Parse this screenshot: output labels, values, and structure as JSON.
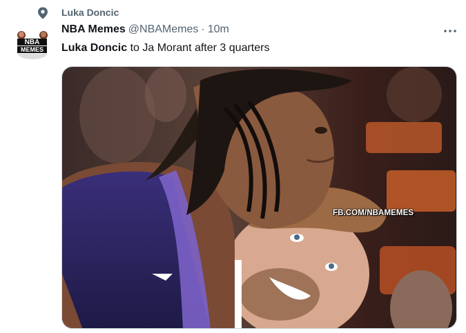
{
  "social_context": {
    "icon": "pin-icon",
    "text": "Luka Doncic"
  },
  "tweet": {
    "avatar": {
      "icon": "nba-memes-logo",
      "logo_text_top": "NBA",
      "logo_text_bottom": "MEMES"
    },
    "display_name": "NBA Memes",
    "handle": "@NBAMemes",
    "separator": "·",
    "time": "10m",
    "more_icon": "more-horizontal-icon",
    "text_bold": "Luka Doncic",
    "text_rest": " to Ja Morant after 3 quarters",
    "media": {
      "watermark": "FB.COM/NBAMEMES"
    }
  },
  "colors": {
    "secondary_text": "#536471",
    "primary_text": "#0f1419",
    "border": "#cfd9de"
  }
}
